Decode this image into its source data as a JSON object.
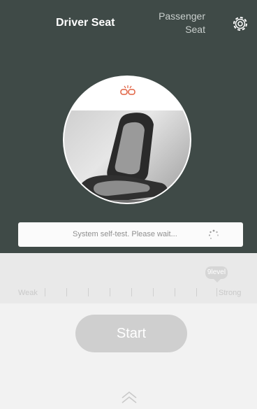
{
  "tabs": {
    "driver": "Driver Seat",
    "passenger_line1": "Passenger",
    "passenger_line2": "Seat"
  },
  "status": {
    "message": "System self-test. Please wait..."
  },
  "intensity": {
    "weak_label": "Weak",
    "strong_label": "Strong",
    "level_badge": "9level",
    "levels": 9
  },
  "actions": {
    "start_label": "Start"
  },
  "icons": {
    "settings": "gear-icon",
    "link": "link-broken-icon",
    "loading": "spinner-icon",
    "expand": "chevron-up-icon"
  },
  "colors": {
    "header_bg": "#3f4a47",
    "link_icon": "#e06040",
    "button_bg": "#cfcfcf"
  }
}
